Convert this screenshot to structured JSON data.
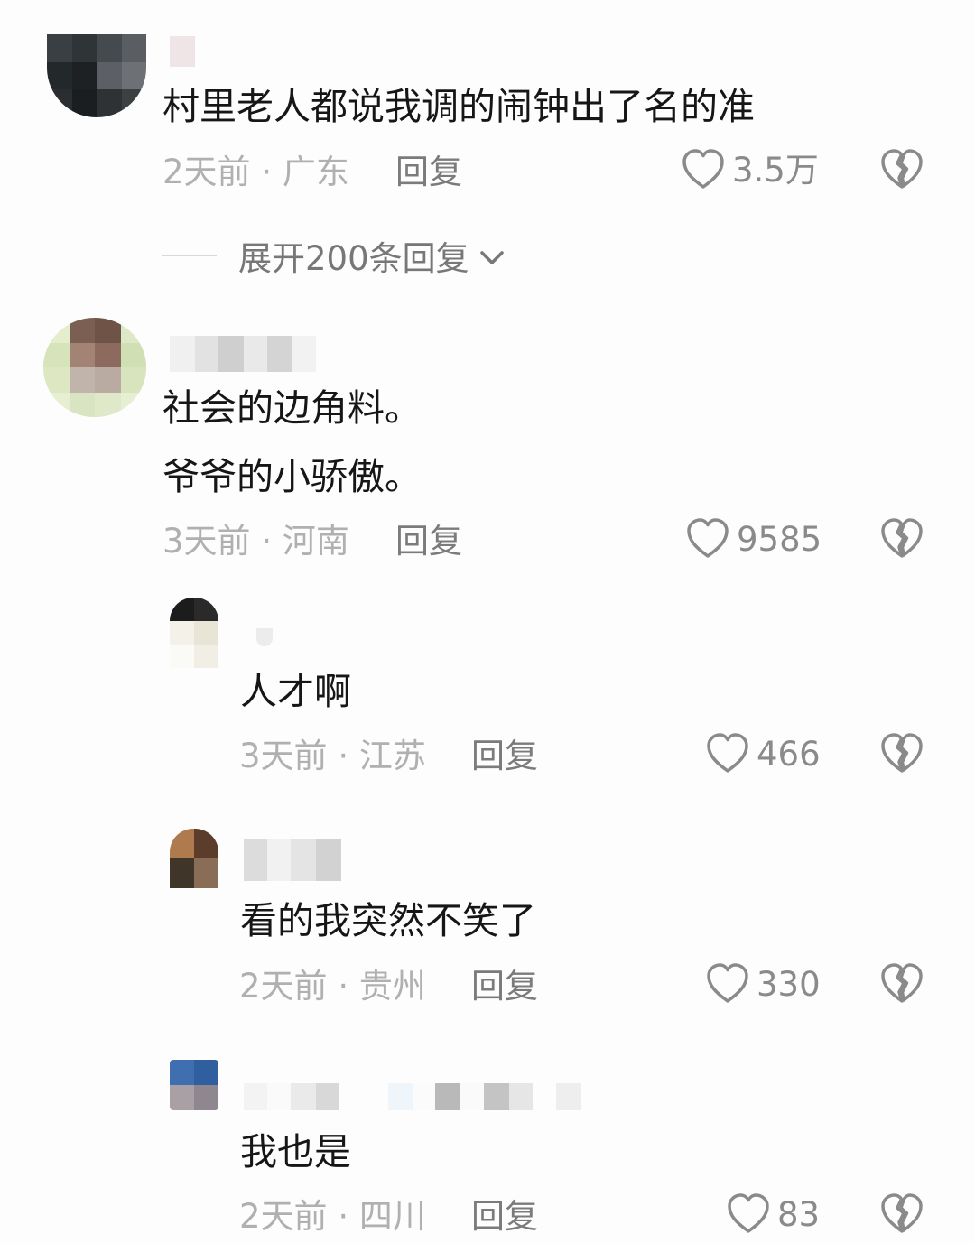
{
  "comments": [
    {
      "text_lines": [
        "村里老人都说我调的闹钟出了名的准"
      ],
      "time": "2天前",
      "location": "广东",
      "reply_label": "回复",
      "likes": "3.5万"
    },
    {
      "text_lines": [
        "社会的边角料。",
        "爷爷的小骄傲。"
      ],
      "time": "3天前",
      "location": "河南",
      "reply_label": "回复",
      "likes": "9585"
    }
  ],
  "expand_replies": "展开200条回复",
  "replies": [
    {
      "text": "人才啊",
      "time": "3天前",
      "location": "江苏",
      "reply_label": "回复",
      "likes": "466"
    },
    {
      "text": "看的我突然不笑了",
      "time": "2天前",
      "location": "贵州",
      "reply_label": "回复",
      "likes": "330"
    },
    {
      "text": "我也是",
      "time": "2天前",
      "location": "四川",
      "reply_label": "回复",
      "likes": "83"
    }
  ],
  "separator": "·",
  "icons": {
    "like": "heart-outline-icon",
    "dislike": "broken-heart-icon",
    "expand": "chevron-down-icon"
  },
  "colors": {
    "text": "#161616",
    "meta": "#b0b0b0",
    "reply": "#7b7b7b",
    "icon": "#8a8a8a"
  }
}
